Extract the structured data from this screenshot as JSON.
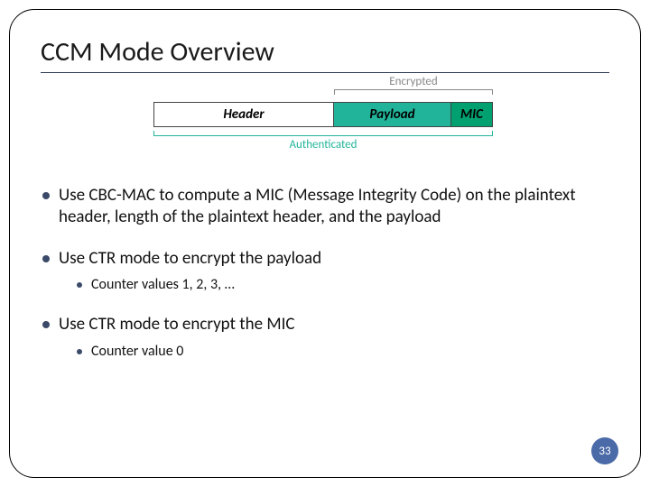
{
  "title": "CCM Mode Overview",
  "diagram": {
    "encrypted_label": "Encrypted",
    "authenticated_label": "Authenticated",
    "header_label": "Header",
    "payload_label": "Payload",
    "mic_label": "MIC"
  },
  "bullets": [
    {
      "text": "Use CBC-MAC to compute a MIC (Message Integrity Code) on the plaintext header, length of the plaintext header, and the payload",
      "sub": []
    },
    {
      "text": "Use CTR mode to encrypt the payload",
      "sub": [
        "Counter values 1, 2, 3, …"
      ]
    },
    {
      "text": "Use CTR mode to encrypt the MIC",
      "sub": [
        "Counter value 0"
      ]
    }
  ],
  "page_number": "33"
}
